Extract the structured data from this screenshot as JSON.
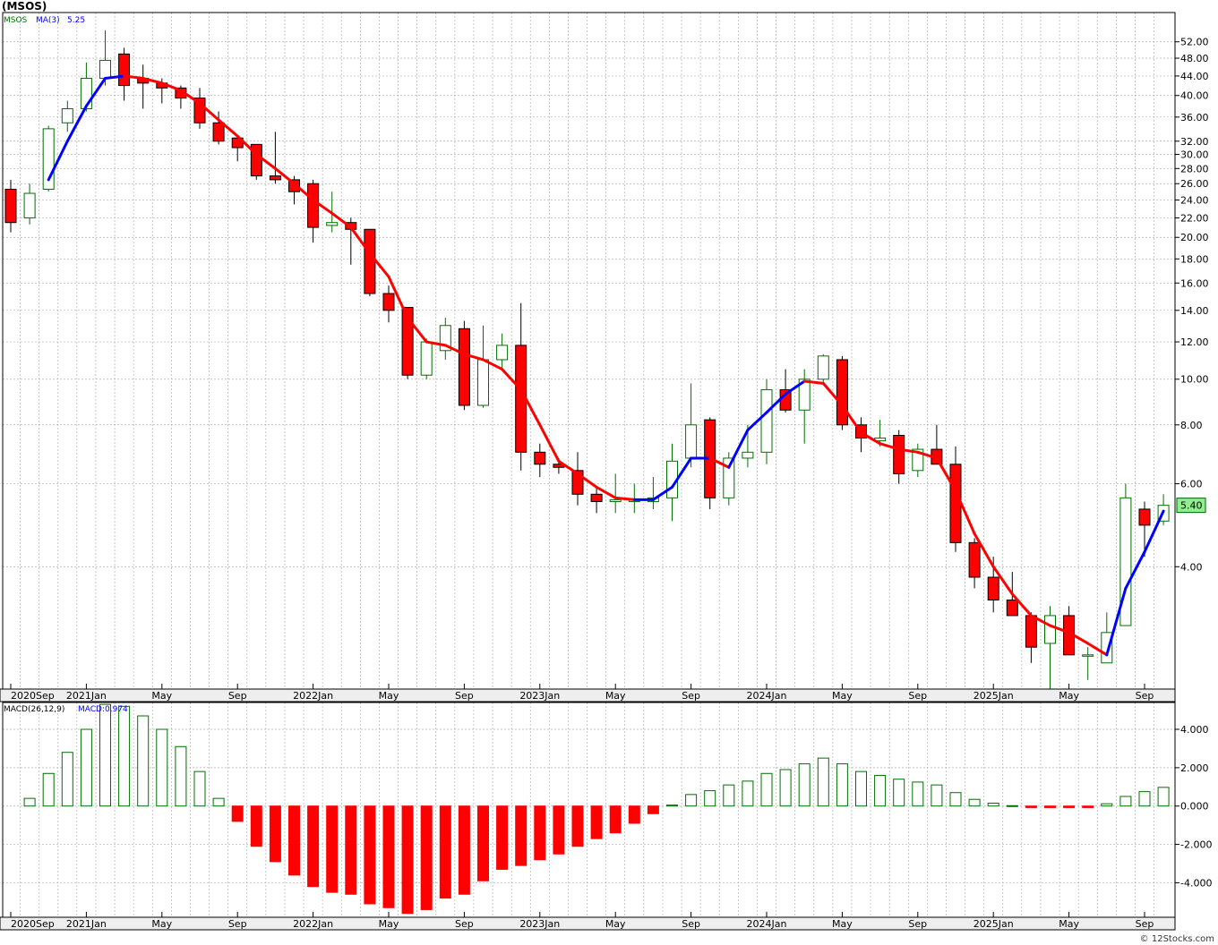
{
  "title": "(MSOS)",
  "watermark": "© 12Stocks.com",
  "colors": {
    "up_candle": "#007000",
    "down_candle": "#ff0000",
    "ma_up": "#0000ff",
    "ma_down": "#ff0000",
    "grid": "#b0b0b0",
    "last_price_bg": "#90ee90"
  },
  "chart_data": [
    {
      "type": "candlestick",
      "legend": {
        "symbol": "MSOS",
        "ma_label": "MA(3)",
        "ma_value": "5.25"
      },
      "y_scale": "log",
      "ylim": [
        2.2,
        60
      ],
      "y_ticks": [
        {
          "v": 52,
          "label": "52.00"
        },
        {
          "v": 48,
          "label": "48.00"
        },
        {
          "v": 44,
          "label": "44.00"
        },
        {
          "v": 40,
          "label": "40.00"
        },
        {
          "v": 36,
          "label": "36.00"
        },
        {
          "v": 32,
          "label": "32.00"
        },
        {
          "v": 30,
          "label": "30.00"
        },
        {
          "v": 28,
          "label": "28.00"
        },
        {
          "v": 26,
          "label": "26.00"
        },
        {
          "v": 24,
          "label": "24.00"
        },
        {
          "v": 22,
          "label": "22.00"
        },
        {
          "v": 20,
          "label": "20.00"
        },
        {
          "v": 18,
          "label": "18.00"
        },
        {
          "v": 16,
          "label": "16.00"
        },
        {
          "v": 14,
          "label": "14.00"
        },
        {
          "v": 12,
          "label": "12.00"
        },
        {
          "v": 10,
          "label": "10.00"
        },
        {
          "v": 8,
          "label": "8.00"
        },
        {
          "v": 6,
          "label": "6.00"
        },
        {
          "v": 4,
          "label": "4.00"
        }
      ],
      "last_price_label": "5.40",
      "x_labels": [
        {
          "i": -0.5,
          "label": "2020Sep"
        },
        {
          "i": 3.5,
          "label": "2021Jan"
        },
        {
          "i": 7.5,
          "label": "May"
        },
        {
          "i": 11.5,
          "label": "Sep"
        },
        {
          "i": 15.5,
          "label": "2022Jan"
        },
        {
          "i": 19.5,
          "label": "May"
        },
        {
          "i": 23.5,
          "label": "Sep"
        },
        {
          "i": 27.5,
          "label": "2023Jan"
        },
        {
          "i": 31.5,
          "label": "May"
        },
        {
          "i": 35.5,
          "label": "Sep"
        },
        {
          "i": 39.5,
          "label": "2024Jan"
        },
        {
          "i": 43.5,
          "label": "May"
        },
        {
          "i": 47.5,
          "label": "Sep"
        },
        {
          "i": 51.5,
          "label": "2025Jan"
        },
        {
          "i": 55.5,
          "label": "May"
        },
        {
          "i": 59.5,
          "label": "Sep"
        }
      ],
      "candles": [
        {
          "o": 25.3,
          "h": 26.5,
          "l": 20.5,
          "c": 21.5
        },
        {
          "o": 22.0,
          "h": 26.0,
          "l": 21.3,
          "c": 24.8
        },
        {
          "o": 25.3,
          "h": 34.5,
          "l": 25.0,
          "c": 34.0
        },
        {
          "o": 35.0,
          "h": 39.0,
          "l": 33.5,
          "c": 37.5
        },
        {
          "o": 37.5,
          "h": 47.0,
          "l": 37.0,
          "c": 43.5
        },
        {
          "o": 43.5,
          "h": 55.0,
          "l": 42.0,
          "c": 47.5
        },
        {
          "o": 49.0,
          "h": 50.5,
          "l": 39.0,
          "c": 42.0
        },
        {
          "o": 43.5,
          "h": 46.5,
          "l": 37.5,
          "c": 42.5
        },
        {
          "o": 42.5,
          "h": 43.5,
          "l": 38.5,
          "c": 41.5
        },
        {
          "o": 41.5,
          "h": 42.0,
          "l": 37.5,
          "c": 39.5
        },
        {
          "o": 39.5,
          "h": 41.5,
          "l": 34.0,
          "c": 35.0
        },
        {
          "o": 35.0,
          "h": 37.0,
          "l": 31.5,
          "c": 32.0
        },
        {
          "o": 32.5,
          "h": 33.0,
          "l": 29.0,
          "c": 31.0
        },
        {
          "o": 31.5,
          "h": 31.5,
          "l": 26.5,
          "c": 27.0
        },
        {
          "o": 27.0,
          "h": 33.5,
          "l": 26.0,
          "c": 26.5
        },
        {
          "o": 26.5,
          "h": 27.0,
          "l": 23.5,
          "c": 25.0
        },
        {
          "o": 26.0,
          "h": 26.5,
          "l": 19.5,
          "c": 21.0
        },
        {
          "o": 21.2,
          "h": 25.0,
          "l": 20.5,
          "c": 21.5
        },
        {
          "o": 21.5,
          "h": 22.0,
          "l": 17.5,
          "c": 20.8
        },
        {
          "o": 20.8,
          "h": 20.8,
          "l": 15.0,
          "c": 15.2
        },
        {
          "o": 15.2,
          "h": 15.8,
          "l": 13.2,
          "c": 14.0
        },
        {
          "o": 14.2,
          "h": 14.2,
          "l": 10.0,
          "c": 10.2
        },
        {
          "o": 10.2,
          "h": 12.2,
          "l": 10.0,
          "c": 12.0
        },
        {
          "o": 11.5,
          "h": 13.5,
          "l": 11.0,
          "c": 13.0
        },
        {
          "o": 12.8,
          "h": 13.3,
          "l": 8.6,
          "c": 8.8
        },
        {
          "o": 8.8,
          "h": 13.0,
          "l": 8.7,
          "c": 11.0
        },
        {
          "o": 11.0,
          "h": 12.5,
          "l": 10.5,
          "c": 11.8
        },
        {
          "o": 11.8,
          "h": 14.5,
          "l": 6.4,
          "c": 7.0
        },
        {
          "o": 7.0,
          "h": 7.3,
          "l": 6.2,
          "c": 6.6
        },
        {
          "o": 6.6,
          "h": 6.8,
          "l": 6.3,
          "c": 6.5
        },
        {
          "o": 6.4,
          "h": 7.0,
          "l": 5.4,
          "c": 5.7
        },
        {
          "o": 5.7,
          "h": 5.9,
          "l": 5.2,
          "c": 5.5
        },
        {
          "o": 5.5,
          "h": 6.3,
          "l": 5.2,
          "c": 5.55
        },
        {
          "o": 5.5,
          "h": 6.0,
          "l": 5.2,
          "c": 5.55
        },
        {
          "o": 5.5,
          "h": 6.2,
          "l": 5.3,
          "c": 5.6
        },
        {
          "o": 5.6,
          "h": 7.3,
          "l": 5.0,
          "c": 6.7
        },
        {
          "o": 6.8,
          "h": 9.8,
          "l": 6.5,
          "c": 8.0
        },
        {
          "o": 8.2,
          "h": 8.3,
          "l": 5.3,
          "c": 5.6
        },
        {
          "o": 5.6,
          "h": 7.0,
          "l": 5.4,
          "c": 6.8
        },
        {
          "o": 6.8,
          "h": 8.0,
          "l": 6.5,
          "c": 7.0
        },
        {
          "o": 7.0,
          "h": 10.0,
          "l": 6.6,
          "c": 9.5
        },
        {
          "o": 9.5,
          "h": 10.5,
          "l": 8.5,
          "c": 8.6
        },
        {
          "o": 8.6,
          "h": 10.5,
          "l": 7.3,
          "c": 10.0
        },
        {
          "o": 10.0,
          "h": 11.3,
          "l": 9.8,
          "c": 11.2
        },
        {
          "o": 11.0,
          "h": 11.2,
          "l": 7.8,
          "c": 8.0
        },
        {
          "o": 8.0,
          "h": 8.3,
          "l": 7.0,
          "c": 7.5
        },
        {
          "o": 7.4,
          "h": 8.2,
          "l": 7.2,
          "c": 7.5
        },
        {
          "o": 7.6,
          "h": 7.8,
          "l": 6.0,
          "c": 6.3
        },
        {
          "o": 6.4,
          "h": 7.3,
          "l": 6.2,
          "c": 7.1
        },
        {
          "o": 7.1,
          "h": 8.0,
          "l": 6.6,
          "c": 6.6
        },
        {
          "o": 6.6,
          "h": 7.2,
          "l": 4.3,
          "c": 4.5
        },
        {
          "o": 4.5,
          "h": 4.6,
          "l": 3.6,
          "c": 3.8
        },
        {
          "o": 3.8,
          "h": 4.2,
          "l": 3.2,
          "c": 3.4
        },
        {
          "o": 3.4,
          "h": 3.9,
          "l": 3.2,
          "c": 3.15
        },
        {
          "o": 3.15,
          "h": 3.2,
          "l": 2.5,
          "c": 2.7
        },
        {
          "o": 2.75,
          "h": 3.3,
          "l": 2.2,
          "c": 3.15
        },
        {
          "o": 3.15,
          "h": 3.3,
          "l": 2.6,
          "c": 2.6
        },
        {
          "o": 2.6,
          "h": 2.7,
          "l": 2.3,
          "c": 2.6
        },
        {
          "o": 2.5,
          "h": 3.2,
          "l": 2.5,
          "c": 2.9
        },
        {
          "o": 3.0,
          "h": 6.0,
          "l": 3.0,
          "c": 5.6
        },
        {
          "o": 5.3,
          "h": 5.5,
          "l": 4.2,
          "c": 4.9
        },
        {
          "o": 5.0,
          "h": 5.7,
          "l": 4.9,
          "c": 5.4
        }
      ],
      "ma": [
        null,
        null,
        26.5,
        32.0,
        38.0,
        43.5,
        44.0,
        43.5,
        42.5,
        41.0,
        38.5,
        35.5,
        32.8,
        30.0,
        28.0,
        26.0,
        24.0,
        22.5,
        21.0,
        18.5,
        16.5,
        13.5,
        12.0,
        11.8,
        11.3,
        11.0,
        10.5,
        9.5,
        8.0,
        6.7,
        6.3,
        5.9,
        5.6,
        5.55,
        5.55,
        5.9,
        6.8,
        6.8,
        6.5,
        7.8,
        8.5,
        9.3,
        9.9,
        9.8,
        8.8,
        7.7,
        7.3,
        7.1,
        7.0,
        6.8,
        5.8,
        4.7,
        4.0,
        3.5,
        3.15,
        3.0,
        2.9,
        2.75,
        2.6,
        3.6,
        4.3,
        5.25
      ]
    },
    {
      "type": "bar",
      "legend": {
        "name": "MACD(26,12,9)",
        "value_label": "MACD:0.974"
      },
      "ylim": [
        -5.8,
        5.4
      ],
      "y_ticks": [
        {
          "v": 4,
          "label": "4.000"
        },
        {
          "v": 2,
          "label": "2.000"
        },
        {
          "v": 0,
          "label": "0.000"
        },
        {
          "v": -2,
          "label": "-2.000"
        },
        {
          "v": -4,
          "label": "-4.000"
        }
      ],
      "x_labels": [
        {
          "i": -0.5,
          "label": "2020Sep"
        },
        {
          "i": 3.5,
          "label": "2021Jan"
        },
        {
          "i": 7.5,
          "label": "May"
        },
        {
          "i": 11.5,
          "label": "Sep"
        },
        {
          "i": 15.5,
          "label": "2022Jan"
        },
        {
          "i": 19.5,
          "label": "May"
        },
        {
          "i": 23.5,
          "label": "Sep"
        },
        {
          "i": 27.5,
          "label": "2023Jan"
        },
        {
          "i": 31.5,
          "label": "May"
        },
        {
          "i": 35.5,
          "label": "Sep"
        },
        {
          "i": 39.5,
          "label": "2024Jan"
        },
        {
          "i": 43.5,
          "label": "May"
        },
        {
          "i": 47.5,
          "label": "Sep"
        },
        {
          "i": 51.5,
          "label": "2025Jan"
        },
        {
          "i": 55.5,
          "label": "May"
        },
        {
          "i": 59.5,
          "label": "Sep"
        }
      ],
      "values": [
        0,
        0.4,
        1.7,
        2.8,
        4.0,
        5.3,
        5.2,
        4.7,
        4.0,
        3.1,
        1.8,
        0.4,
        -0.8,
        -2.1,
        -2.9,
        -3.6,
        -4.2,
        -4.5,
        -4.6,
        -5.1,
        -5.3,
        -5.6,
        -5.4,
        -4.8,
        -4.6,
        -3.9,
        -3.3,
        -3.1,
        -2.8,
        -2.5,
        -2.1,
        -1.7,
        -1.4,
        -0.9,
        -0.4,
        0.05,
        0.6,
        0.8,
        1.1,
        1.3,
        1.7,
        1.9,
        2.2,
        2.5,
        2.2,
        1.8,
        1.6,
        1.4,
        1.25,
        1.1,
        0.7,
        0.35,
        0.15,
        0.02,
        -0.08,
        -0.08,
        -0.08,
        -0.08,
        0.12,
        0.5,
        0.75,
        0.974
      ]
    }
  ]
}
